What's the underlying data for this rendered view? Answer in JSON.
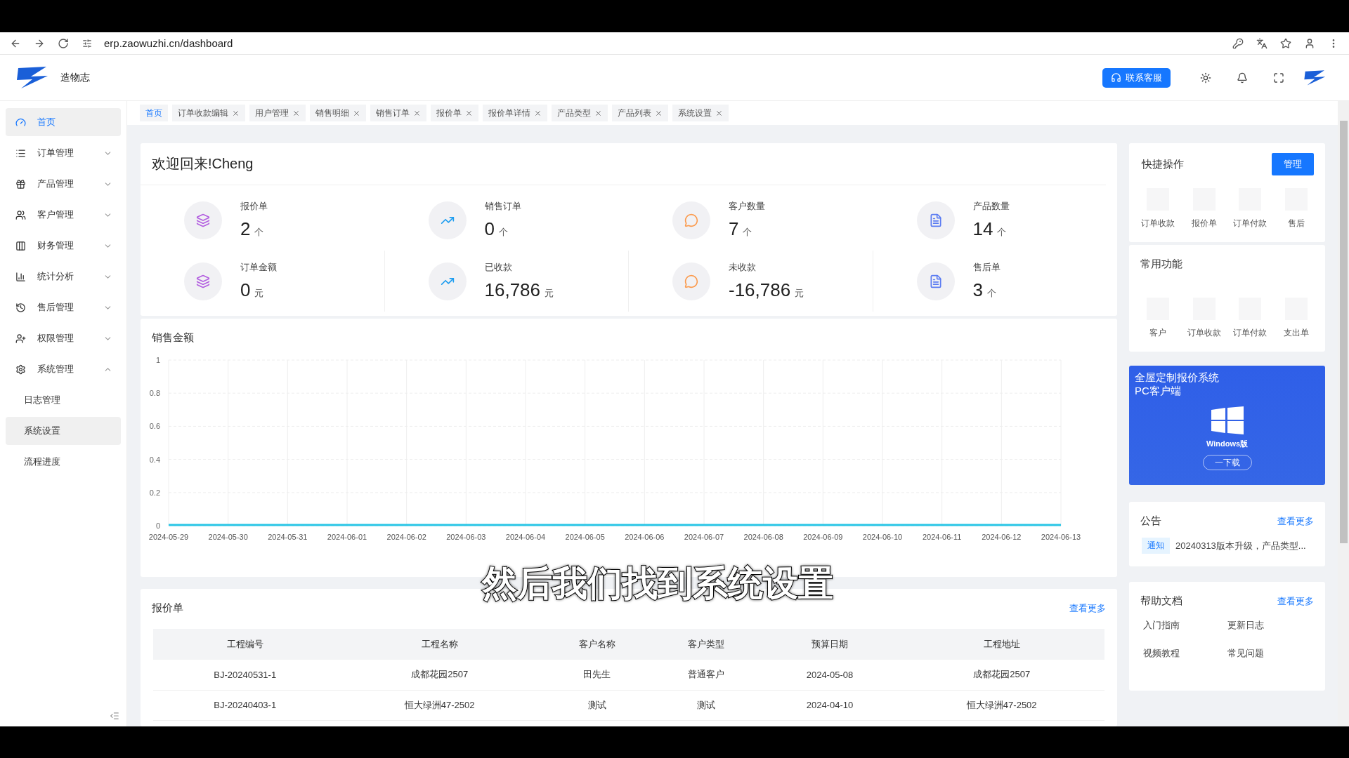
{
  "browser": {
    "url": "erp.zaowuzhi.cn/dashboard"
  },
  "app": {
    "name": "造物志",
    "support_button": "联系客服"
  },
  "sidebar": {
    "items": [
      {
        "label": "首页",
        "kind": "link",
        "selected": true
      },
      {
        "label": "订单管理",
        "kind": "group",
        "expanded": false
      },
      {
        "label": "产品管理",
        "kind": "group",
        "expanded": false
      },
      {
        "label": "客户管理",
        "kind": "group",
        "expanded": false
      },
      {
        "label": "财务管理",
        "kind": "group",
        "expanded": false
      },
      {
        "label": "统计分析",
        "kind": "group",
        "expanded": false
      },
      {
        "label": "售后管理",
        "kind": "group",
        "expanded": false
      },
      {
        "label": "权限管理",
        "kind": "group",
        "expanded": false
      },
      {
        "label": "系统管理",
        "kind": "group",
        "expanded": true,
        "children": [
          {
            "label": "日志管理",
            "hovered": false
          },
          {
            "label": "系统设置",
            "hovered": true
          },
          {
            "label": "流程进度",
            "hovered": false
          }
        ]
      }
    ]
  },
  "tabs": [
    {
      "label": "首页",
      "selected": true,
      "closable": false
    },
    {
      "label": "订单收款编辑",
      "selected": false,
      "closable": true
    },
    {
      "label": "用户管理",
      "selected": false,
      "closable": true
    },
    {
      "label": "销售明细",
      "selected": false,
      "closable": true
    },
    {
      "label": "销售订单",
      "selected": false,
      "closable": true
    },
    {
      "label": "报价单",
      "selected": false,
      "closable": true
    },
    {
      "label": "报价单详情",
      "selected": false,
      "closable": true
    },
    {
      "label": "产品类型",
      "selected": false,
      "closable": true
    },
    {
      "label": "产品列表",
      "selected": false,
      "closable": true
    },
    {
      "label": "系统设置",
      "selected": false,
      "closable": true
    }
  ],
  "welcome": {
    "title": "欢迎回来!Cheng",
    "stats": [
      {
        "kind": "purple",
        "label": "报价单",
        "value": "2",
        "unit": "个"
      },
      {
        "kind": "blue",
        "label": "销售订单",
        "value": "0",
        "unit": "个"
      },
      {
        "kind": "orange",
        "label": "客户数量",
        "value": "7",
        "unit": "个"
      },
      {
        "kind": "indigo",
        "label": "产品数量",
        "value": "14",
        "unit": "个"
      },
      {
        "kind": "purple",
        "label": "订单金额",
        "value": "0",
        "unit": "元"
      },
      {
        "kind": "blue",
        "label": "已收款",
        "value": "16,786",
        "unit": "元"
      },
      {
        "kind": "orange",
        "label": "未收款",
        "value": "-16,786",
        "unit": "元"
      },
      {
        "kind": "indigo",
        "label": "售后单",
        "value": "3",
        "unit": "个"
      }
    ]
  },
  "sales_chart": {
    "chart_data": {
      "type": "line",
      "title": "销售金额",
      "grid": true,
      "categories": [
        "2024-05-29",
        "2024-05-30",
        "2024-05-31",
        "2024-06-01",
        "2024-06-02",
        "2024-06-03",
        "2024-06-04",
        "2024-06-05",
        "2024-06-06",
        "2024-06-07",
        "2024-06-08",
        "2024-06-09",
        "2024-06-10",
        "2024-06-11",
        "2024-06-12",
        "2024-06-13"
      ],
      "series": [
        {
          "color": "#29c5e6",
          "values": [
            0,
            0,
            0,
            0,
            0,
            0,
            0,
            0,
            0,
            0,
            0,
            0,
            0,
            0,
            0,
            0
          ]
        }
      ],
      "ylim": [
        0,
        1
      ],
      "yticks": [
        0,
        0.2,
        0.4,
        0.6,
        0.8,
        1
      ]
    }
  },
  "quotes": {
    "title": "报价单",
    "more_link": "查看更多",
    "columns": [
      "工程编号",
      "工程名称",
      "客户名称",
      "客户类型",
      "预算日期",
      "工程地址"
    ],
    "rows": [
      [
        "BJ-20240531-1",
        "成都花园2507",
        "田先生",
        "普通客户",
        "2024-05-08",
        "成都花园2507"
      ],
      [
        "BJ-20240403-1",
        "恒大绿洲47-2502",
        "测试",
        "测试",
        "2024-04-10",
        "恒大绿洲47-2502"
      ]
    ]
  },
  "quick_actions": {
    "title": "快捷操作",
    "manage_button": "管理",
    "items": [
      "订单收款",
      "报价单",
      "订单付款",
      "售后"
    ]
  },
  "common_functions": {
    "title": "常用功能",
    "items": [
      "客户",
      "订单收款",
      "订单付款",
      "支出单"
    ]
  },
  "promo": {
    "title": "全屋定制报价系统",
    "subtitle": "PC客户端",
    "platform": "Windows版",
    "download_button": "一下载"
  },
  "notices": {
    "title": "公告",
    "more_link": "查看更多",
    "items": [
      {
        "tag": "通知",
        "text": "20240313版本升级，产品类型..."
      }
    ]
  },
  "help": {
    "title": "帮助文档",
    "more_link": "查看更多",
    "items": [
      "入门指南",
      "更新日志",
      "视频教程",
      "常见问题"
    ]
  },
  "video_subtitle": "然后我们找到系统设置"
}
